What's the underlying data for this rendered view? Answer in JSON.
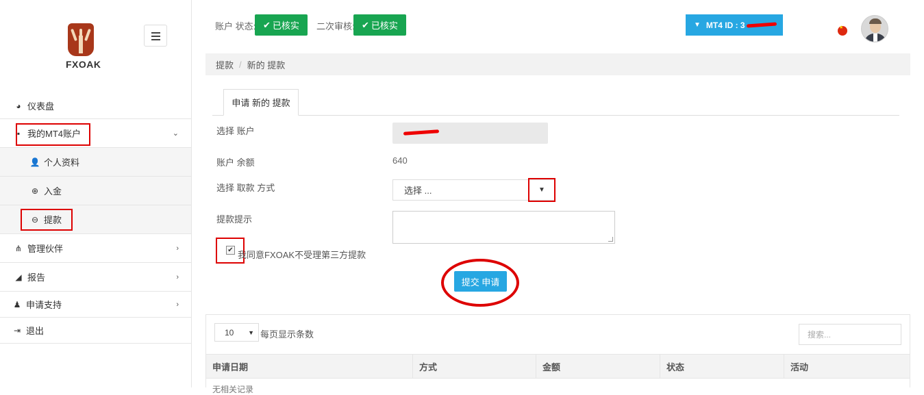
{
  "brand": {
    "name": "FXOAK"
  },
  "sidebar": {
    "items": [
      {
        "label": "仪表盘",
        "icon": "dashboard-icon"
      },
      {
        "label": "我的MT4账户",
        "icon": "grid-icon",
        "expanded": true
      },
      {
        "label": "个人资料",
        "icon": "user-icon",
        "sub": true
      },
      {
        "label": "入金",
        "icon": "plus-circle-icon",
        "sub": true
      },
      {
        "label": "提款",
        "icon": "minus-circle-icon",
        "sub": true
      },
      {
        "label": "管理伙伴",
        "icon": "sitemap-icon"
      },
      {
        "label": "报告",
        "icon": "bullhorn-icon"
      },
      {
        "label": "申请支持",
        "icon": "support-icon"
      },
      {
        "label": "退出",
        "icon": "sign-out-icon"
      }
    ]
  },
  "header": {
    "account_status_label": "账户 状态:",
    "account_status_badge": "已核实",
    "second_review_label": "二次审核:",
    "second_review_badge": "已核实",
    "mt4_label": "MT4 ID : 3",
    "badge_color": "#18a551",
    "accent_color": "#27a7e2"
  },
  "breadcrumb": {
    "root": "提款",
    "current": "新的 提款"
  },
  "tab": {
    "label": "申请 新的 提款"
  },
  "form": {
    "account_label": "选择 账户",
    "balance_label": "账户 余额",
    "balance_value": "640",
    "method_label": "选择 取款 方式",
    "method_placeholder": "选择 ...",
    "hint_label": "提款提示",
    "agree_text": "我同意FXOAK不受理第三方提款",
    "agree_checked": true,
    "submit_label": "提交 申请"
  },
  "table": {
    "page_length": "10",
    "page_length_label": "每页显示条数",
    "search_placeholder": "搜索...",
    "columns": [
      "申请日期",
      "方式",
      "金额",
      "状态",
      "活动"
    ],
    "empty_text": "无相关记录"
  }
}
